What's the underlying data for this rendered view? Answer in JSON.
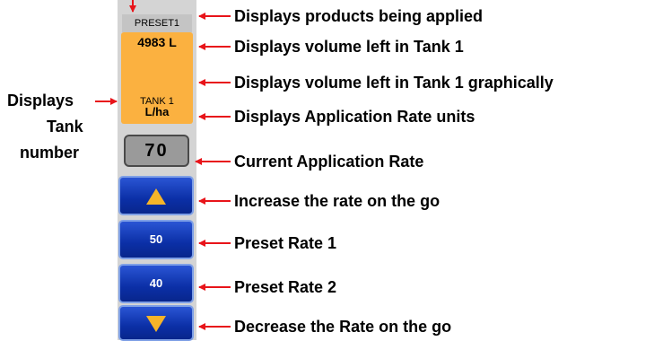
{
  "tank_panel": {
    "preset_name": "PRESET1",
    "volume": "4983 L",
    "tank_number": "TANK 1",
    "rate_units": "L/ha",
    "current_rate": "70",
    "preset_rate_1": "50",
    "preset_rate_2": "40",
    "increase_icon": "triangle-up-icon",
    "decrease_icon": "triangle-down-icon"
  },
  "callouts": {
    "products": "Displays products being applied",
    "volume_left": "Displays volume left in Tank 1",
    "volume_graphic": "Displays volume left in Tank 1 graphically",
    "rate_units": "Displays Application Rate units",
    "current_rate": "Current Application Rate",
    "increase": "Increase the rate on the go",
    "preset1": "Preset Rate 1",
    "preset2": "Preset Rate 2",
    "decrease": "Decrease the Rate on the go"
  },
  "left_callout": [
    "Displays",
    "Tank",
    "number"
  ],
  "colors": {
    "arrow": "#e8141a",
    "tank_fill": "#fbb140",
    "button_blue": "#0b2fa6",
    "triangle": "#f6b429"
  }
}
